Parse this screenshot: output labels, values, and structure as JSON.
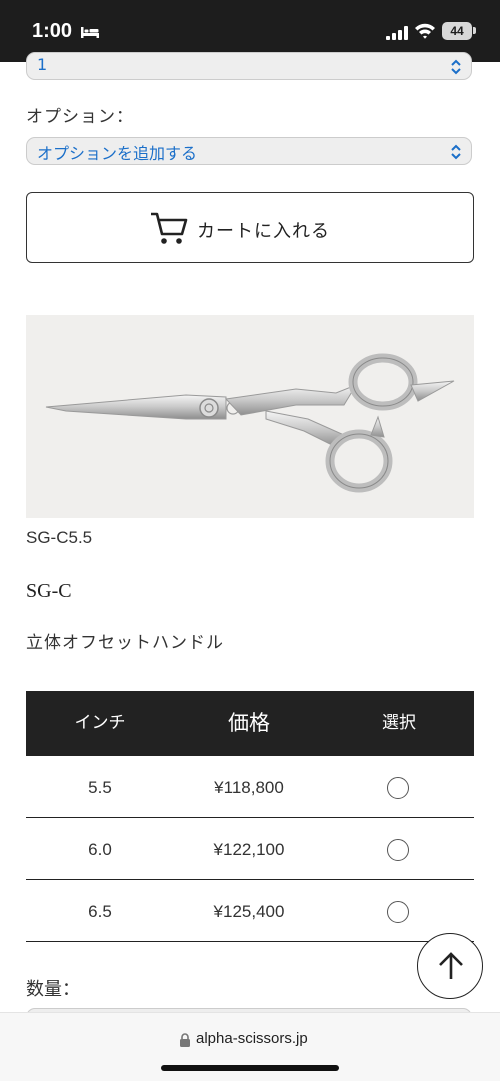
{
  "status_bar": {
    "time": "1:00",
    "battery": "44",
    "icons": [
      "bed-icon",
      "signal-icon",
      "wifi-icon",
      "battery-icon"
    ]
  },
  "quantity_select_top": {
    "value": "1"
  },
  "option": {
    "label": "オプション：",
    "value": "オプションを追加する"
  },
  "cart_button": {
    "label": "カートに入れる",
    "icon": "cart-icon"
  },
  "product": {
    "model_code": "SG-C5.5",
    "series": "SG-C",
    "feature": "立体オフセットハンドル"
  },
  "price_table": {
    "headers": {
      "inch": "インチ",
      "price": "価格",
      "select": "選択"
    },
    "rows": [
      {
        "inch": "5.5",
        "price": "¥118,800",
        "selected": false
      },
      {
        "inch": "6.0",
        "price": "¥122,100",
        "selected": false
      },
      {
        "inch": "6.5",
        "price": "¥125,400",
        "selected": false
      }
    ]
  },
  "quantity": {
    "label": "数量："
  },
  "scroll_top": {
    "icon": "arrow-up-icon"
  },
  "browser": {
    "url": "alpha-scissors.jp"
  },
  "colors": {
    "select_text": "#1b6fc9",
    "table_header_bg": "#222222",
    "status_bar_bg": "#1d1d1d"
  }
}
